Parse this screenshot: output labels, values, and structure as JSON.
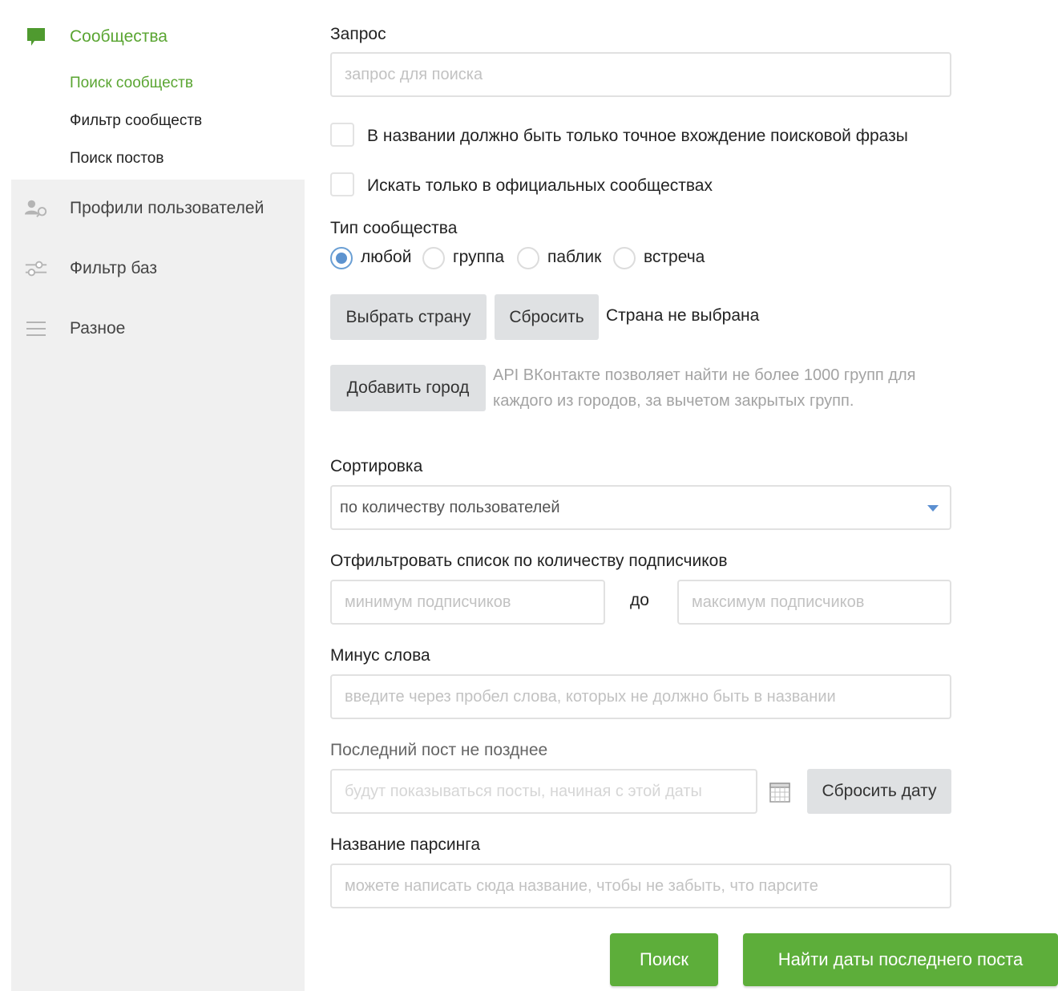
{
  "sidebar": {
    "communities": {
      "label": "Сообщества",
      "icon": "chat-bubble-icon",
      "items": [
        "Поиск сообществ",
        "Фильтр сообществ",
        "Поиск постов"
      ]
    },
    "profiles": {
      "label": "Профили пользователей",
      "icon": "user-search-icon"
    },
    "filter_bases": {
      "label": "Фильтр баз",
      "icon": "sliders-icon"
    },
    "misc": {
      "label": "Разное",
      "icon": "menu-lines-icon"
    }
  },
  "form": {
    "query": {
      "label": "Запрос",
      "placeholder": "запрос для поиска",
      "value": ""
    },
    "exact_match": {
      "label": "В названии должно быть только точное вхождение поисковой фразы",
      "checked": false
    },
    "official_only": {
      "label": "Искать только в официальных сообществах",
      "checked": false
    },
    "community_type": {
      "label": "Тип сообщества",
      "options": [
        "любой",
        "группа",
        "паблик",
        "встреча"
      ],
      "selected": "любой"
    },
    "country": {
      "choose_button": "Выбрать страну",
      "reset_button": "Сбросить",
      "status": "Страна не выбрана"
    },
    "city": {
      "add_button": "Добавить город",
      "hint": "API ВКонтакте позволяет найти не более 1000 групп для каждого из городов, за вычетом закрытых групп."
    },
    "sorting": {
      "label": "Сортировка",
      "value": "по количеству пользователей"
    },
    "subscribers": {
      "label": "Отфильтровать список по количеству подписчиков",
      "min_placeholder": "минимум подписчиков",
      "separator": "до",
      "max_placeholder": "максимум подписчиков"
    },
    "minus_words": {
      "label": "Минус слова",
      "placeholder": "введите через пробел слова, которых не должно быть в названии"
    },
    "last_post": {
      "label": "Последний пост не позднее",
      "placeholder": "будут показываться посты, начиная с этой даты",
      "reset_button": "Сбросить дату"
    },
    "parse_name": {
      "label": "Название парсинга",
      "placeholder": "можете написать сюда название, чтобы не забыть, что парсите"
    },
    "search_button": "Поиск",
    "find_dates_button": "Найти даты последнего поста"
  },
  "colors": {
    "accent_green": "#5dae3a",
    "sidebar_bg": "#f0f0f0",
    "radio_blue": "#5d93cf",
    "gray_button": "#dfe1e3"
  }
}
